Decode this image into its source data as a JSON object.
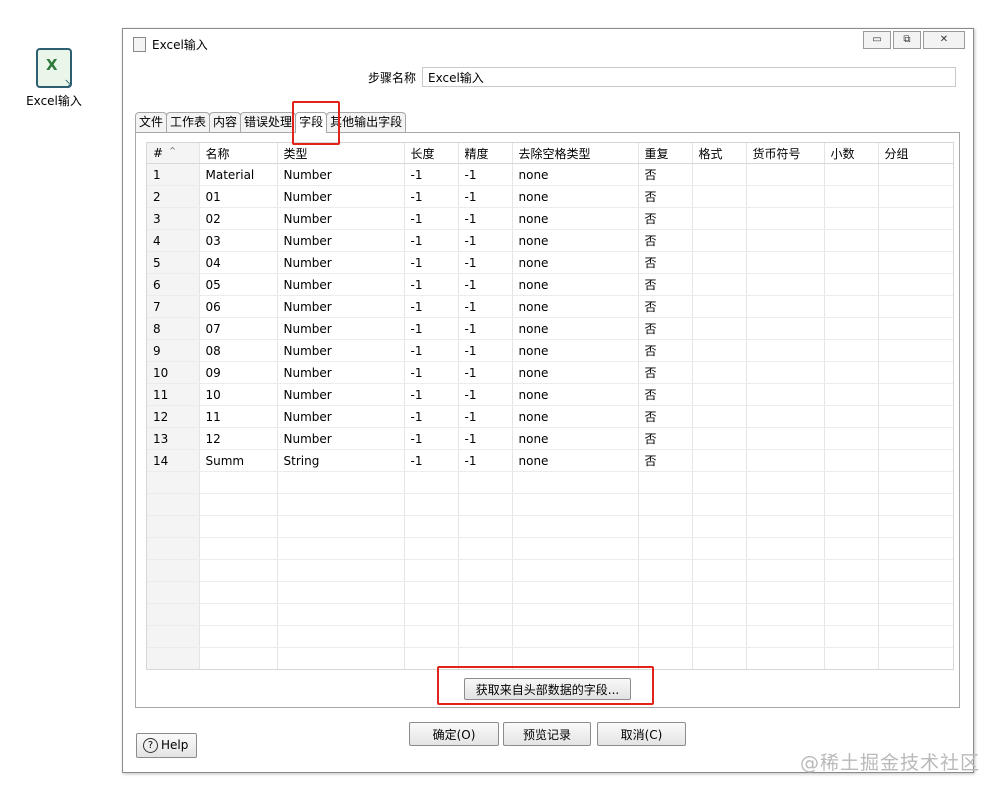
{
  "desktop_icon": {
    "label": "Excel输入"
  },
  "window": {
    "title": "Excel输入",
    "controls": {
      "minimize": "▭",
      "restore": "⧉",
      "close": "✕"
    }
  },
  "step_name": {
    "label": "步骤名称",
    "value": "Excel输入"
  },
  "tabs": [
    {
      "label": "文件"
    },
    {
      "label": "工作表"
    },
    {
      "label": "内容"
    },
    {
      "label": "错误处理"
    },
    {
      "label": "字段",
      "active": true
    },
    {
      "label": "其他输出字段"
    }
  ],
  "table": {
    "columns": [
      "#",
      "名称",
      "类型",
      "长度",
      "精度",
      "去除空格类型",
      "重复",
      "格式",
      "货币符号",
      "小数",
      "分组"
    ],
    "rows": [
      [
        "1",
        "Material",
        "Number",
        "-1",
        "-1",
        "none",
        "否",
        "",
        "",
        "",
        ""
      ],
      [
        "2",
        "01",
        "Number",
        "-1",
        "-1",
        "none",
        "否",
        "",
        "",
        "",
        ""
      ],
      [
        "3",
        "02",
        "Number",
        "-1",
        "-1",
        "none",
        "否",
        "",
        "",
        "",
        ""
      ],
      [
        "4",
        "03",
        "Number",
        "-1",
        "-1",
        "none",
        "否",
        "",
        "",
        "",
        ""
      ],
      [
        "5",
        "04",
        "Number",
        "-1",
        "-1",
        "none",
        "否",
        "",
        "",
        "",
        ""
      ],
      [
        "6",
        "05",
        "Number",
        "-1",
        "-1",
        "none",
        "否",
        "",
        "",
        "",
        ""
      ],
      [
        "7",
        "06",
        "Number",
        "-1",
        "-1",
        "none",
        "否",
        "",
        "",
        "",
        ""
      ],
      [
        "8",
        "07",
        "Number",
        "-1",
        "-1",
        "none",
        "否",
        "",
        "",
        "",
        ""
      ],
      [
        "9",
        "08",
        "Number",
        "-1",
        "-1",
        "none",
        "否",
        "",
        "",
        "",
        ""
      ],
      [
        "10",
        "09",
        "Number",
        "-1",
        "-1",
        "none",
        "否",
        "",
        "",
        "",
        ""
      ],
      [
        "11",
        "10",
        "Number",
        "-1",
        "-1",
        "none",
        "否",
        "",
        "",
        "",
        ""
      ],
      [
        "12",
        "11",
        "Number",
        "-1",
        "-1",
        "none",
        "否",
        "",
        "",
        "",
        ""
      ],
      [
        "13",
        "12",
        "Number",
        "-1",
        "-1",
        "none",
        "否",
        "",
        "",
        "",
        ""
      ],
      [
        "14",
        "Summ",
        "String",
        "-1",
        "-1",
        "none",
        "否",
        "",
        "",
        "",
        ""
      ]
    ],
    "empty_rows": 10
  },
  "buttons": {
    "get_fields": "获取来自头部数据的字段...",
    "ok": "确定(O)",
    "preview": "预览记录",
    "cancel": "取消(C)",
    "help": "Help"
  },
  "watermark": "@稀土掘金技术社区",
  "colors": {
    "highlight": "#e0241b"
  }
}
